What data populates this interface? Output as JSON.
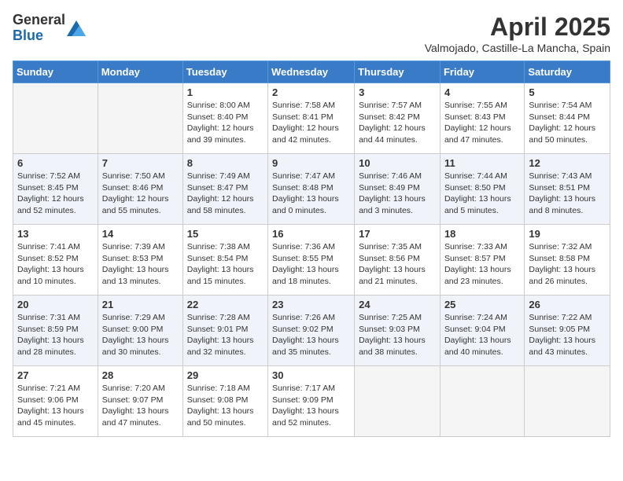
{
  "header": {
    "logo_general": "General",
    "logo_blue": "Blue",
    "month_title": "April 2025",
    "location": "Valmojado, Castille-La Mancha, Spain"
  },
  "weekdays": [
    "Sunday",
    "Monday",
    "Tuesday",
    "Wednesday",
    "Thursday",
    "Friday",
    "Saturday"
  ],
  "weeks": [
    [
      {
        "day": "",
        "sunrise": "",
        "sunset": "",
        "daylight": "",
        "empty": true
      },
      {
        "day": "",
        "sunrise": "",
        "sunset": "",
        "daylight": "",
        "empty": true
      },
      {
        "day": "1",
        "sunrise": "Sunrise: 8:00 AM",
        "sunset": "Sunset: 8:40 PM",
        "daylight": "Daylight: 12 hours and 39 minutes."
      },
      {
        "day": "2",
        "sunrise": "Sunrise: 7:58 AM",
        "sunset": "Sunset: 8:41 PM",
        "daylight": "Daylight: 12 hours and 42 minutes."
      },
      {
        "day": "3",
        "sunrise": "Sunrise: 7:57 AM",
        "sunset": "Sunset: 8:42 PM",
        "daylight": "Daylight: 12 hours and 44 minutes."
      },
      {
        "day": "4",
        "sunrise": "Sunrise: 7:55 AM",
        "sunset": "Sunset: 8:43 PM",
        "daylight": "Daylight: 12 hours and 47 minutes."
      },
      {
        "day": "5",
        "sunrise": "Sunrise: 7:54 AM",
        "sunset": "Sunset: 8:44 PM",
        "daylight": "Daylight: 12 hours and 50 minutes."
      }
    ],
    [
      {
        "day": "6",
        "sunrise": "Sunrise: 7:52 AM",
        "sunset": "Sunset: 8:45 PM",
        "daylight": "Daylight: 12 hours and 52 minutes."
      },
      {
        "day": "7",
        "sunrise": "Sunrise: 7:50 AM",
        "sunset": "Sunset: 8:46 PM",
        "daylight": "Daylight: 12 hours and 55 minutes."
      },
      {
        "day": "8",
        "sunrise": "Sunrise: 7:49 AM",
        "sunset": "Sunset: 8:47 PM",
        "daylight": "Daylight: 12 hours and 58 minutes."
      },
      {
        "day": "9",
        "sunrise": "Sunrise: 7:47 AM",
        "sunset": "Sunset: 8:48 PM",
        "daylight": "Daylight: 13 hours and 0 minutes."
      },
      {
        "day": "10",
        "sunrise": "Sunrise: 7:46 AM",
        "sunset": "Sunset: 8:49 PM",
        "daylight": "Daylight: 13 hours and 3 minutes."
      },
      {
        "day": "11",
        "sunrise": "Sunrise: 7:44 AM",
        "sunset": "Sunset: 8:50 PM",
        "daylight": "Daylight: 13 hours and 5 minutes."
      },
      {
        "day": "12",
        "sunrise": "Sunrise: 7:43 AM",
        "sunset": "Sunset: 8:51 PM",
        "daylight": "Daylight: 13 hours and 8 minutes."
      }
    ],
    [
      {
        "day": "13",
        "sunrise": "Sunrise: 7:41 AM",
        "sunset": "Sunset: 8:52 PM",
        "daylight": "Daylight: 13 hours and 10 minutes."
      },
      {
        "day": "14",
        "sunrise": "Sunrise: 7:39 AM",
        "sunset": "Sunset: 8:53 PM",
        "daylight": "Daylight: 13 hours and 13 minutes."
      },
      {
        "day": "15",
        "sunrise": "Sunrise: 7:38 AM",
        "sunset": "Sunset: 8:54 PM",
        "daylight": "Daylight: 13 hours and 15 minutes."
      },
      {
        "day": "16",
        "sunrise": "Sunrise: 7:36 AM",
        "sunset": "Sunset: 8:55 PM",
        "daylight": "Daylight: 13 hours and 18 minutes."
      },
      {
        "day": "17",
        "sunrise": "Sunrise: 7:35 AM",
        "sunset": "Sunset: 8:56 PM",
        "daylight": "Daylight: 13 hours and 21 minutes."
      },
      {
        "day": "18",
        "sunrise": "Sunrise: 7:33 AM",
        "sunset": "Sunset: 8:57 PM",
        "daylight": "Daylight: 13 hours and 23 minutes."
      },
      {
        "day": "19",
        "sunrise": "Sunrise: 7:32 AM",
        "sunset": "Sunset: 8:58 PM",
        "daylight": "Daylight: 13 hours and 26 minutes."
      }
    ],
    [
      {
        "day": "20",
        "sunrise": "Sunrise: 7:31 AM",
        "sunset": "Sunset: 8:59 PM",
        "daylight": "Daylight: 13 hours and 28 minutes."
      },
      {
        "day": "21",
        "sunrise": "Sunrise: 7:29 AM",
        "sunset": "Sunset: 9:00 PM",
        "daylight": "Daylight: 13 hours and 30 minutes."
      },
      {
        "day": "22",
        "sunrise": "Sunrise: 7:28 AM",
        "sunset": "Sunset: 9:01 PM",
        "daylight": "Daylight: 13 hours and 32 minutes."
      },
      {
        "day": "23",
        "sunrise": "Sunrise: 7:26 AM",
        "sunset": "Sunset: 9:02 PM",
        "daylight": "Daylight: 13 hours and 35 minutes."
      },
      {
        "day": "24",
        "sunrise": "Sunrise: 7:25 AM",
        "sunset": "Sunset: 9:03 PM",
        "daylight": "Daylight: 13 hours and 38 minutes."
      },
      {
        "day": "25",
        "sunrise": "Sunrise: 7:24 AM",
        "sunset": "Sunset: 9:04 PM",
        "daylight": "Daylight: 13 hours and 40 minutes."
      },
      {
        "day": "26",
        "sunrise": "Sunrise: 7:22 AM",
        "sunset": "Sunset: 9:05 PM",
        "daylight": "Daylight: 13 hours and 43 minutes."
      }
    ],
    [
      {
        "day": "27",
        "sunrise": "Sunrise: 7:21 AM",
        "sunset": "Sunset: 9:06 PM",
        "daylight": "Daylight: 13 hours and 45 minutes."
      },
      {
        "day": "28",
        "sunrise": "Sunrise: 7:20 AM",
        "sunset": "Sunset: 9:07 PM",
        "daylight": "Daylight: 13 hours and 47 minutes."
      },
      {
        "day": "29",
        "sunrise": "Sunrise: 7:18 AM",
        "sunset": "Sunset: 9:08 PM",
        "daylight": "Daylight: 13 hours and 50 minutes."
      },
      {
        "day": "30",
        "sunrise": "Sunrise: 7:17 AM",
        "sunset": "Sunset: 9:09 PM",
        "daylight": "Daylight: 13 hours and 52 minutes."
      },
      {
        "day": "",
        "sunrise": "",
        "sunset": "",
        "daylight": "",
        "empty": true
      },
      {
        "day": "",
        "sunrise": "",
        "sunset": "",
        "daylight": "",
        "empty": true
      },
      {
        "day": "",
        "sunrise": "",
        "sunset": "",
        "daylight": "",
        "empty": true
      }
    ]
  ]
}
